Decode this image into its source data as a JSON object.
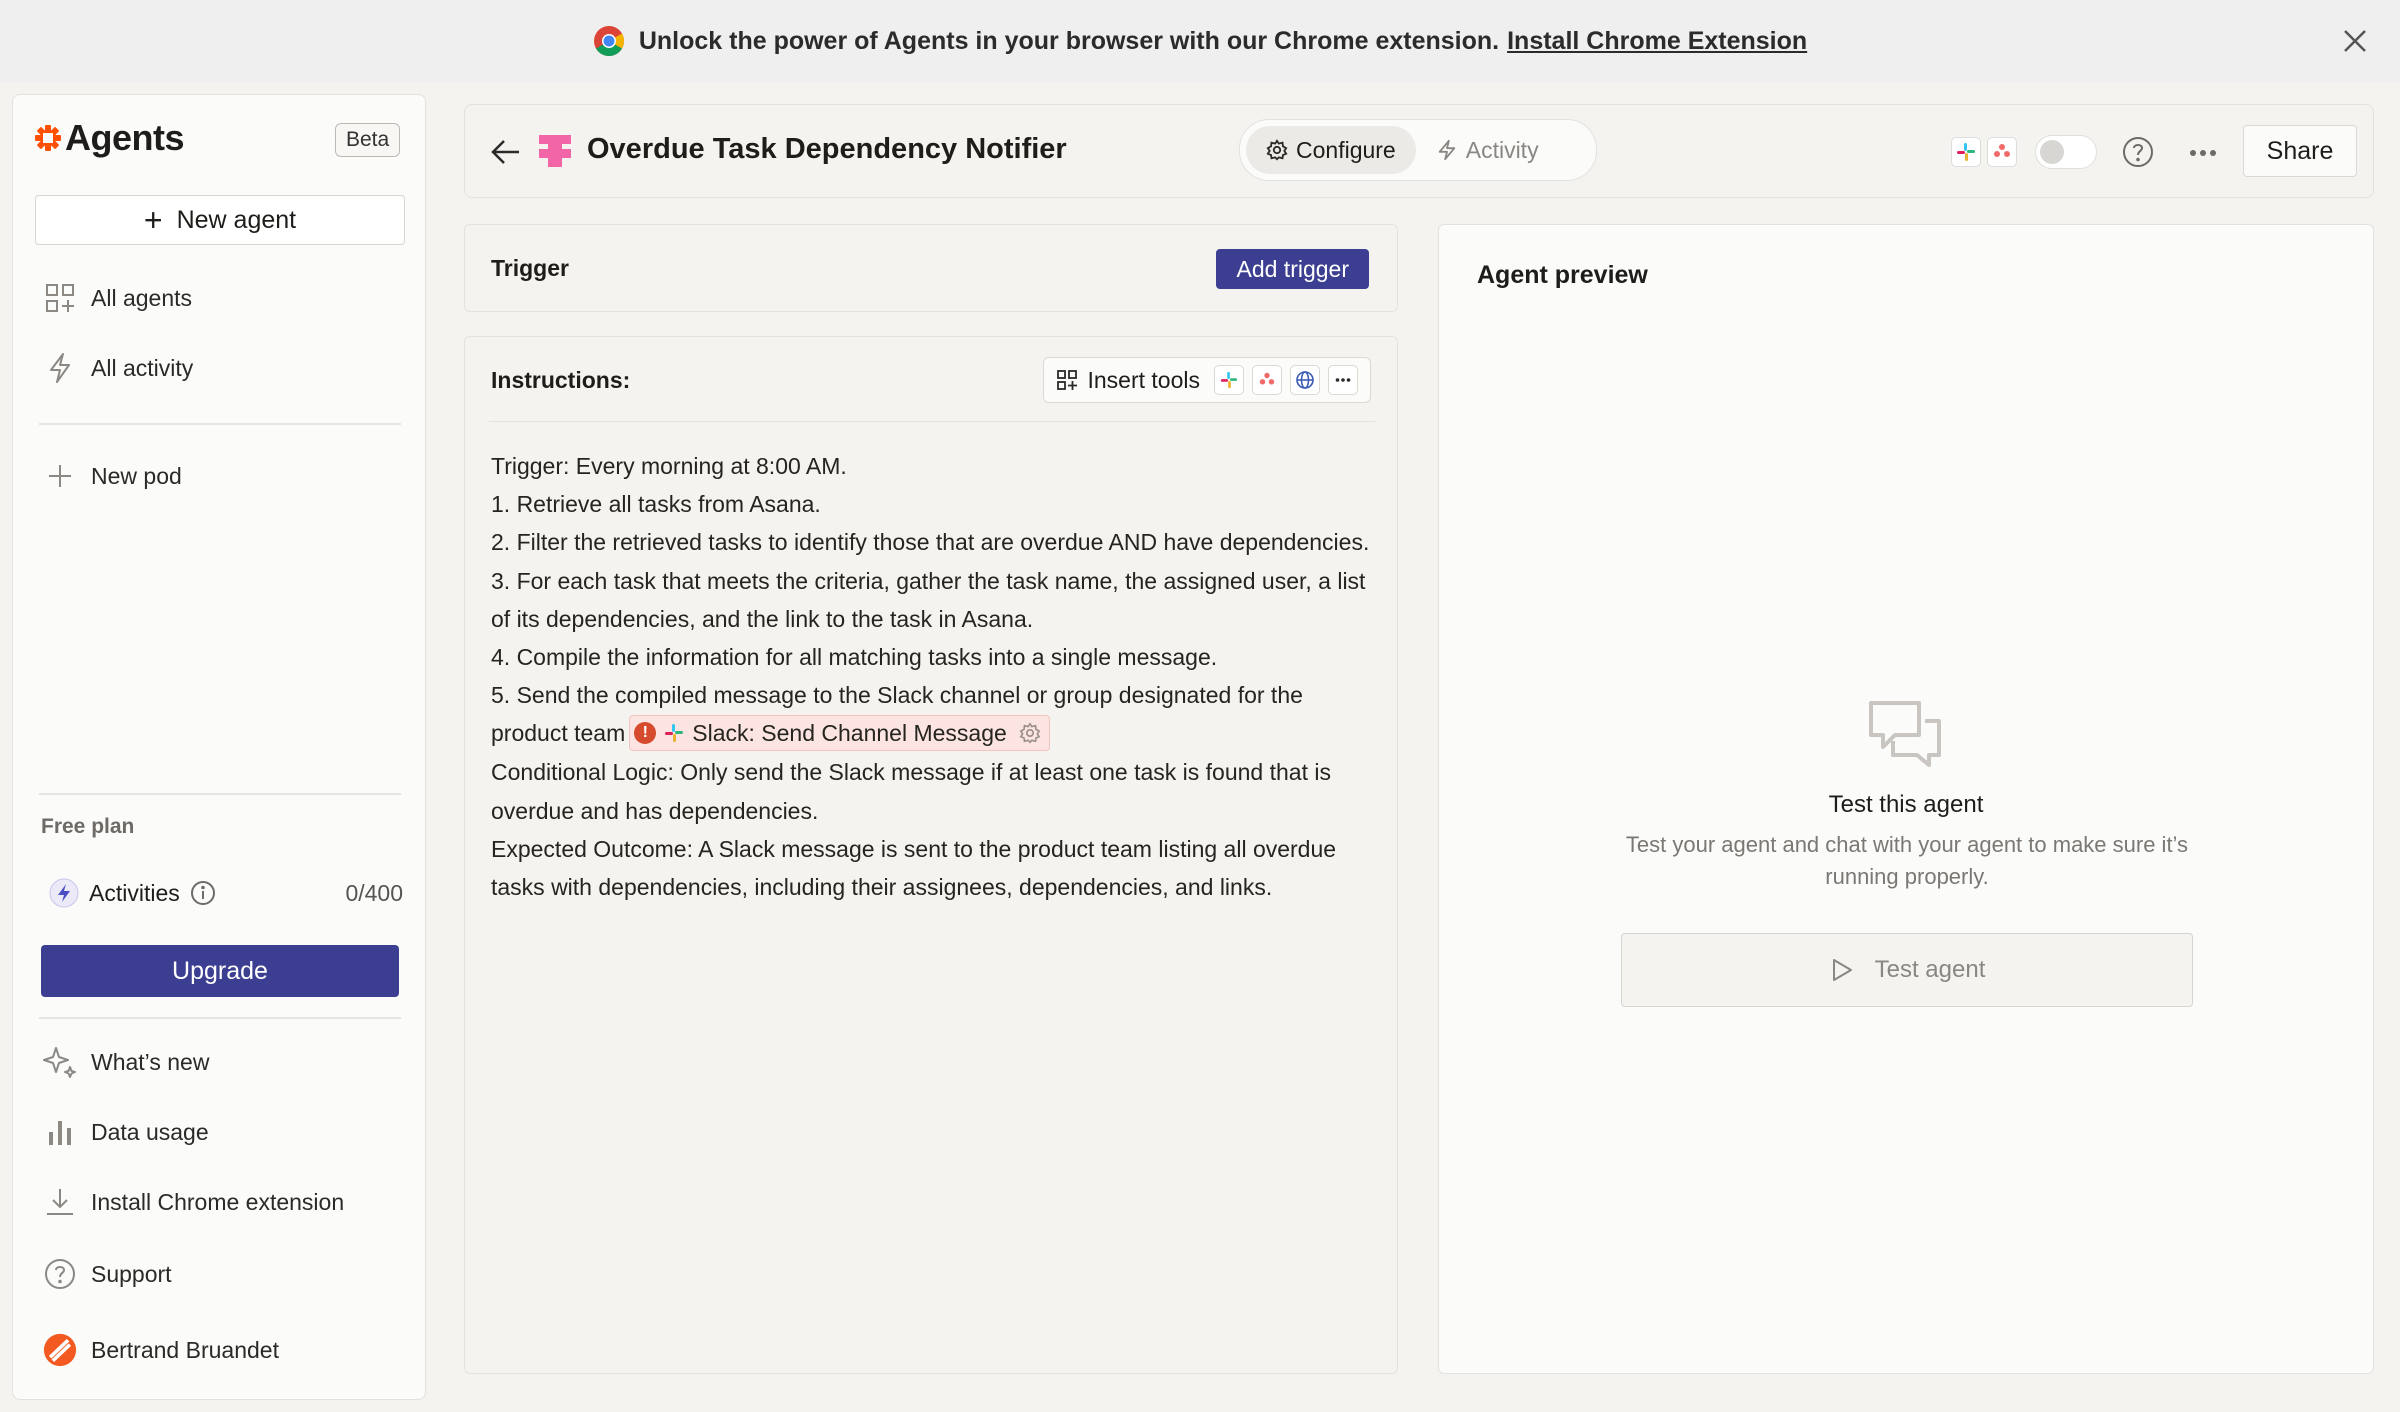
{
  "banner": {
    "text": "Unlock the power of Agents in your browser with our Chrome extension.",
    "link": "Install Chrome Extension"
  },
  "sidebar": {
    "brand": "Agents",
    "badge": "Beta",
    "new_agent": "New agent",
    "nav": [
      {
        "label": "All agents",
        "icon": "grid-icon"
      },
      {
        "label": "All activity",
        "icon": "bolt-icon"
      }
    ],
    "new_pod": "New pod",
    "plan": {
      "label": "Free plan",
      "activities_label": "Activities",
      "activities_count": "0/400",
      "upgrade": "Upgrade"
    },
    "footer": [
      {
        "label": "What’s new",
        "icon": "sparkle-icon"
      },
      {
        "label": "Data usage",
        "icon": "bar-chart-icon"
      },
      {
        "label": "Install Chrome extension",
        "icon": "download-icon"
      },
      {
        "label": "Support",
        "icon": "help-circle-icon"
      },
      {
        "label": "Bertrand Bruandet",
        "icon": "user-avatar"
      }
    ]
  },
  "header": {
    "title": "Overdue Task Dependency Notifier",
    "tabs": [
      {
        "label": "Configure",
        "active": true
      },
      {
        "label": "Activity",
        "active": false
      }
    ],
    "share": "Share"
  },
  "trigger": {
    "label": "Trigger",
    "button": "Add trigger"
  },
  "instructions": {
    "label": "Instructions:",
    "insert_tools": "Insert tools",
    "lines": [
      "Trigger: Every morning at 8:00 AM.",
      "1. Retrieve all tasks from Asana.",
      "2. Filter the retrieved tasks to identify those that are overdue AND have dependencies.",
      "3. For each task that meets the criteria, gather the task name, the assigned user, a list of its dependencies, and the link to the task in Asana.",
      "4. Compile the information for all matching tasks into a single message.",
      "5. Send the compiled message to the Slack channel or group designated for the product team"
    ],
    "tool_pill": "Slack: Send Channel Message",
    "after_lines": [
      "Conditional Logic: Only send the Slack message if at least one task is found that is overdue and has dependencies.",
      "Expected Outcome: A Slack message is sent to the product team listing all overdue tasks with dependencies, including their assignees, dependencies, and links."
    ]
  },
  "preview": {
    "title": "Agent preview",
    "test_title": "Test this agent",
    "test_desc": "Test your agent and chat with your agent to make sure it’s running properly.",
    "test_button": "Test agent"
  },
  "colors": {
    "accent": "#3c3f91",
    "brand": "#ff4f00",
    "warning": "#d64a2d"
  }
}
